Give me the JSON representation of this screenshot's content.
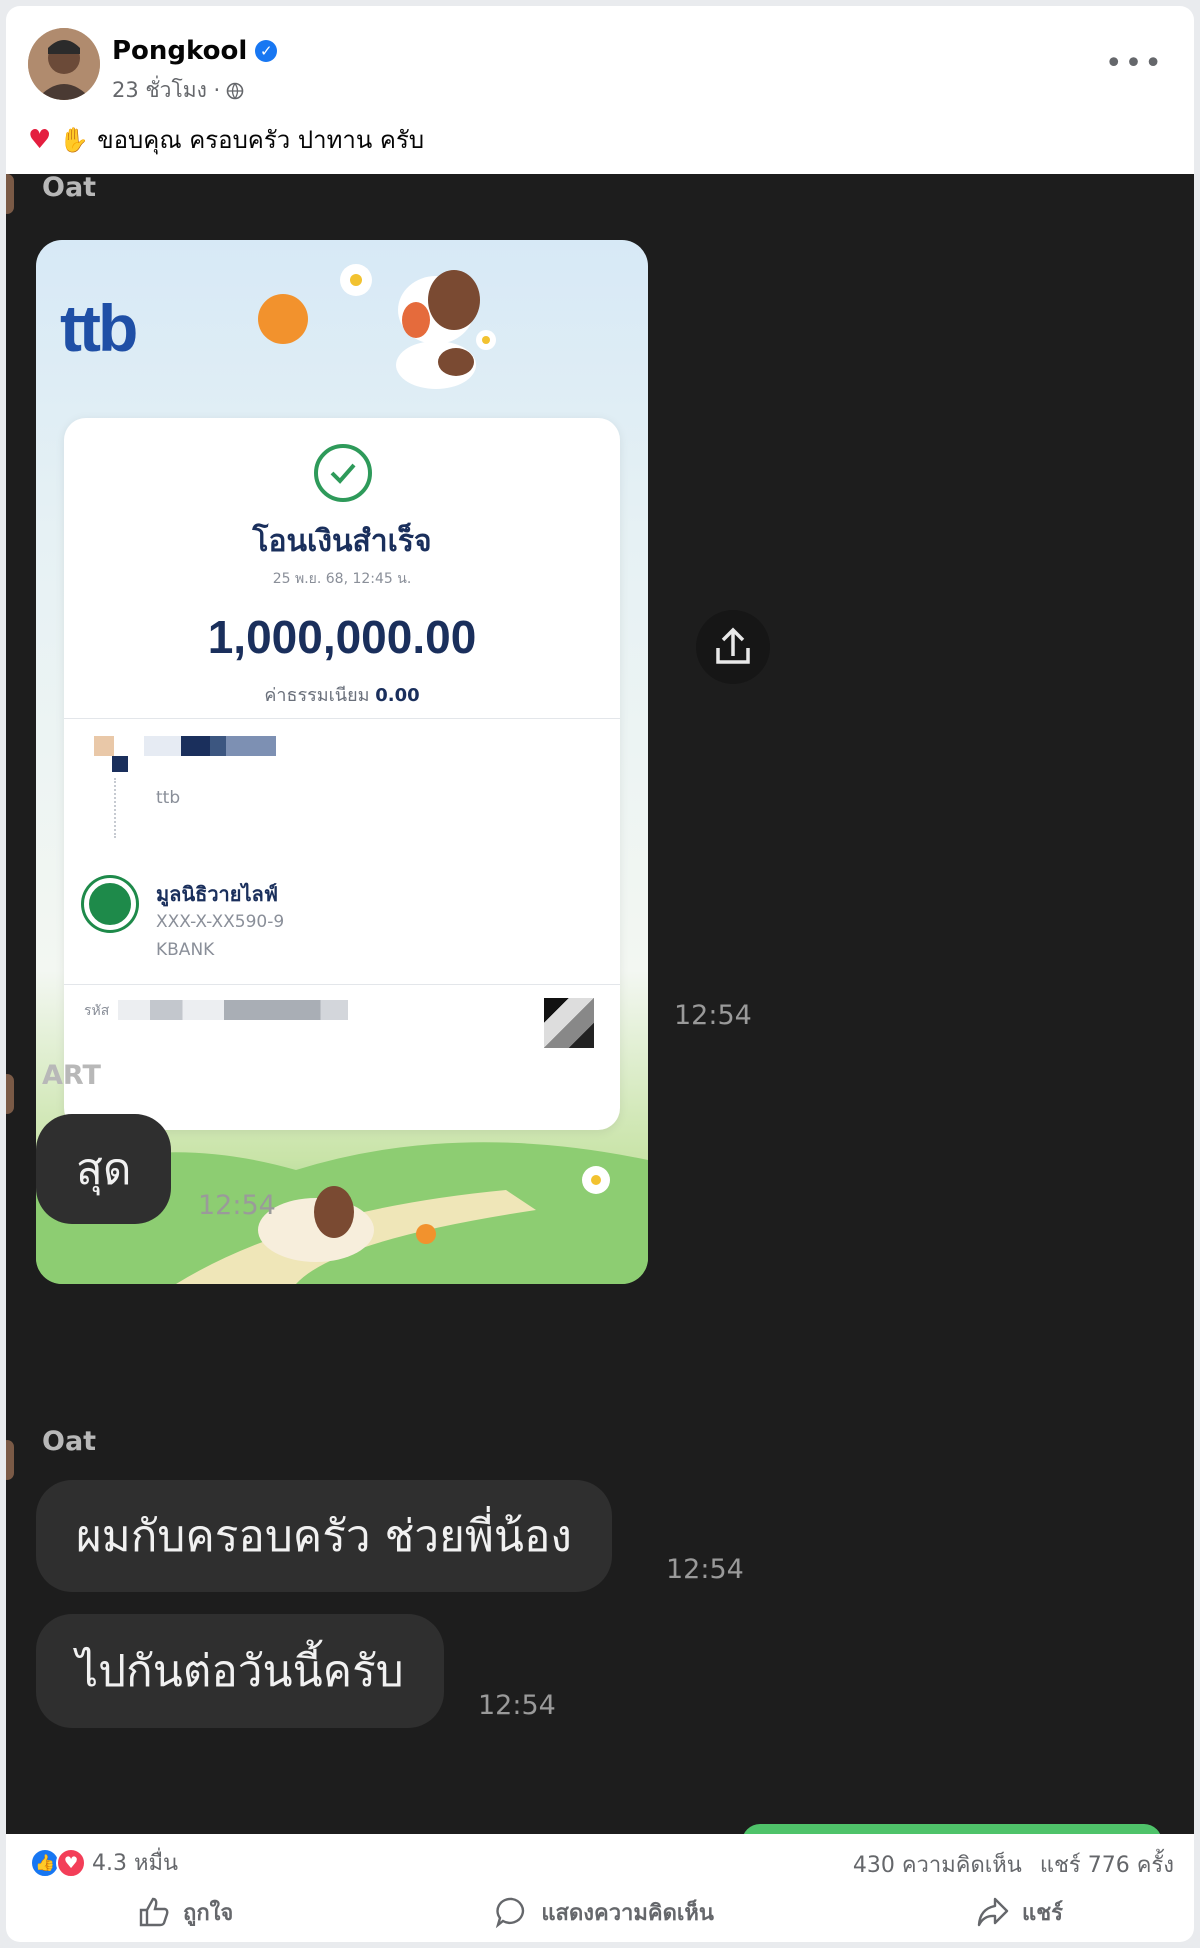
{
  "post": {
    "author": "Pongkool",
    "time_ago": "23 ชั่วโมง ·",
    "caption": "ขอบคุณ ครอบครัว ปาทาน ครับ",
    "caption_emoji": [
      "❤️",
      "🙏"
    ]
  },
  "chat": {
    "messages": [
      {
        "sender": "Oat",
        "type": "image",
        "time": "12:54"
      },
      {
        "sender": "ART",
        "text": "สุด",
        "time": "12:54"
      },
      {
        "sender": "Oat",
        "text": "ผมกับครอบครัว ช่วยพี่น้อง",
        "time": "12:54"
      },
      {
        "text": "ไปกันต่อวันนี้ครับ",
        "time": "12:54"
      }
    ],
    "receipt": {
      "bank_logo": "ttb",
      "status": "โอนเงินสำเร็จ",
      "date": "25 พ.ย. 68, 12:45 น.",
      "amount": "1,000,000.00",
      "fee_label": "ค่าธรรมเนียม",
      "fee_value": "0.00",
      "from_bank": "ttb",
      "to_name": "มูลนิธิวายไลฟ์",
      "to_account": "XXX-X-XX590-9",
      "to_bank": "KBANK",
      "ref_label": "รหัส"
    }
  },
  "stats": {
    "reactions_count": "4.3 หมื่น",
    "comments": "430 ความคิดเห็น",
    "shares": "แชร์ 776 ครั้ง"
  },
  "actions": {
    "like": "ถูกใจ",
    "comment": "แสดงความคิดเห็น",
    "share": "แชร์"
  },
  "colors": {
    "chat_bg": "#1d1d1d",
    "bubble": "#2f2f2f",
    "accent": "#1877f2",
    "ttb_blue": "#1f4fa6",
    "kbank_green": "#1e8a4a"
  }
}
